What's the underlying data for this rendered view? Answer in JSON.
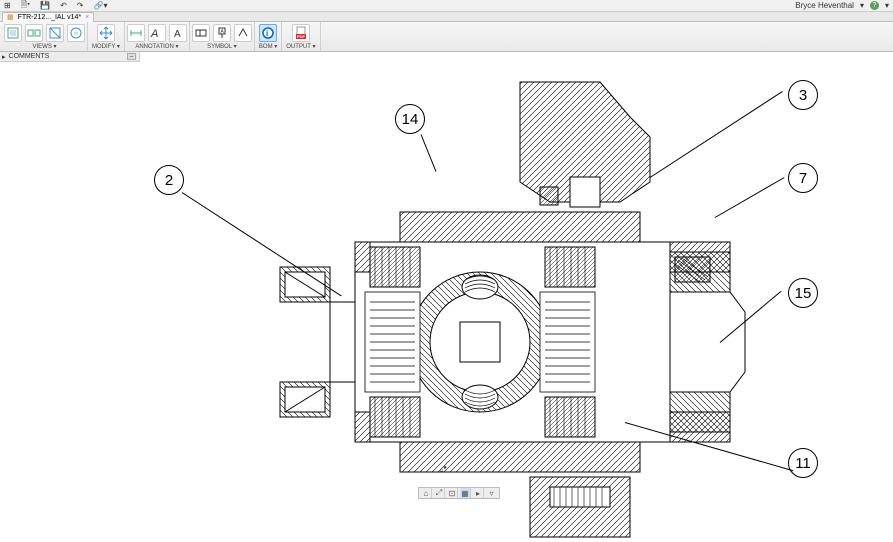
{
  "topbar": {
    "user": "Bryce Heventhal",
    "qat_items": [
      "grid",
      "file",
      "save",
      "undo",
      "redo",
      "link"
    ]
  },
  "tab": {
    "title": "FTR-212..._IAL v14*",
    "close": "×"
  },
  "ribbon": {
    "groups": {
      "views": "VIEWS ▾",
      "modify": "MODIFY ▾",
      "annotation": "ANNOTATION ▾",
      "symbol": "SYMBOL ▾",
      "bom": "BOM ▾",
      "output": "OUTPUT ▾"
    }
  },
  "comments": {
    "title": "COMMENTS",
    "toggle": "–"
  },
  "balloons": {
    "b14": "14",
    "b2": "2",
    "b3": "3",
    "b7": "7",
    "b15": "15",
    "b11": "11"
  },
  "navbar": [
    "⌂",
    "⤢",
    "⊡",
    "▦",
    "▸",
    "▿"
  ]
}
